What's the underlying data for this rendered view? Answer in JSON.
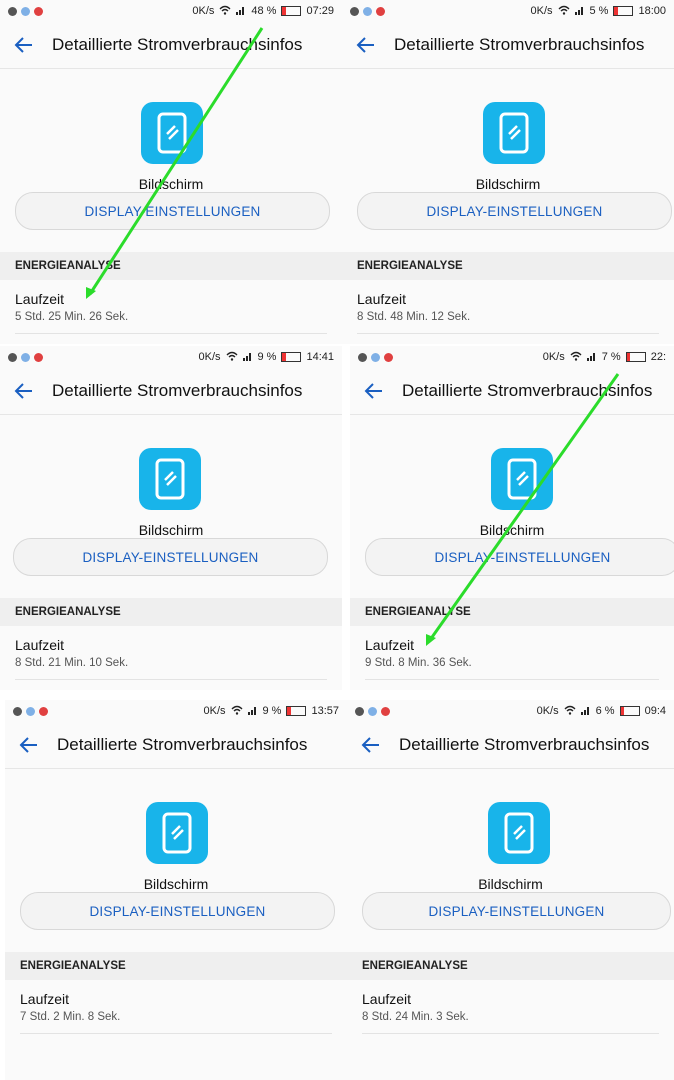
{
  "colors": {
    "accent": "#1a5fc1",
    "icon_bg": "#18b4ea",
    "arrow": "#2bdc2b",
    "battery_low": "#e33333"
  },
  "panels": [
    {
      "speed": "0K/s",
      "battery": "48 %",
      "time": "07:29",
      "title": "Detaillierte Stromverbrauchsinfos",
      "app": "Bildschirm",
      "button": "DISPLAY-EINSTELLUNGEN",
      "section": "ENERGIEANALYSE",
      "label": "Laufzeit",
      "value": "5 Std. 25 Min. 26 Sek."
    },
    {
      "speed": "0K/s",
      "battery": "5 %",
      "time": "18:00",
      "title": "Detaillierte Stromverbrauchsinfos",
      "app": "Bildschirm",
      "button": "DISPLAY-EINSTELLUNGEN",
      "section": "ENERGIEANALYSE",
      "label": "Laufzeit",
      "value": "8 Std. 48 Min. 12 Sek."
    },
    {
      "speed": "0K/s",
      "battery": "9 %",
      "time": "14:41",
      "title": "Detaillierte Stromverbrauchsinfos",
      "app": "Bildschirm",
      "button": "DISPLAY-EINSTELLUNGEN",
      "section": "ENERGIEANALYSE",
      "label": "Laufzeit",
      "value": "8 Std. 21 Min. 10 Sek."
    },
    {
      "speed": "0K/s",
      "battery": "7 %",
      "time": "22:",
      "title": "Detaillierte Stromverbrauchsinfos",
      "app": "Bildschirm",
      "button": "DISPLAY-EINSTELLUNGEN",
      "section": "ENERGIEANALYSE",
      "label": "Laufzeit",
      "value": "9 Std. 8 Min. 36 Sek."
    },
    {
      "speed": "0K/s",
      "battery": "9 %",
      "time": "13:57",
      "title": "Detaillierte Stromverbrauchsinfos",
      "app": "Bildschirm",
      "button": "DISPLAY-EINSTELLUNGEN",
      "section": "ENERGIEANALYSE",
      "label": "Laufzeit",
      "value": "7 Std. 2 Min. 8 Sek."
    },
    {
      "speed": "0K/s",
      "battery": "6 %",
      "time": "09:4",
      "title": "Detaillierte Stromverbrauchsinfos",
      "app": "Bildschirm",
      "button": "DISPLAY-EINSTELLUNGEN",
      "section": "ENERGIEANALYSE",
      "label": "Laufzeit",
      "value": "8 Std. 24 Min. 3 Sek."
    }
  ]
}
